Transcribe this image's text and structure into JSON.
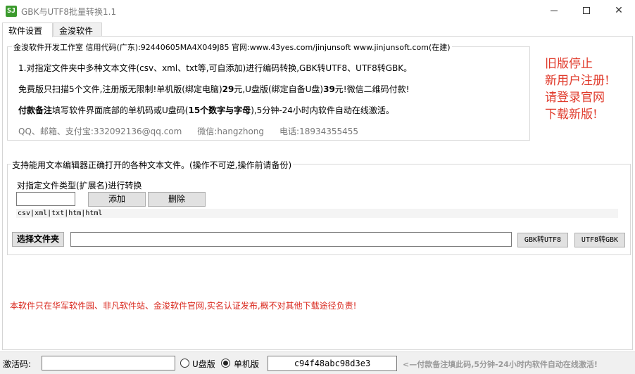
{
  "window": {
    "title": "GBK与UTF8批量转换1.1",
    "icon_text": "SJ"
  },
  "tabs": [
    {
      "label": "软件设置",
      "active": true
    },
    {
      "label": "金浚软件",
      "active": false
    }
  ],
  "info_group": {
    "legend": "金浚软件开发工作室 信用代码(广东):92440605MA4X049J85 官网:www.43yes.com/jinjunsoft  www.jinjunsoft.com(在建)",
    "line1": "1.对指定文件夹中多种文本文件(csv、xml、txt等,可自添加)进行编码转换,GBK转UTF8、UTF8转GBK。",
    "line2_a": "免费版只扫描5个文件,注册版无限制!单机版(绑定电脑)",
    "line2_price1": "29",
    "line2_b": "元,U盘版(绑定自备U盘)",
    "line2_price2": "39",
    "line2_c": "元!微信二维码付款!",
    "line3_bold": "付款备注",
    "line3_a": "填写软件界面底部的单机码或U盘码(",
    "line3_bold2": "15个数字与字母",
    "line3_b": "),5分钟-24小时内软件自动在线激活。",
    "contact_qq": "QQ、邮箱、支付宝:332092136@qq.com",
    "contact_wechat": "微信:hangzhong",
    "contact_phone": "电话:18934355455"
  },
  "red_notice": [
    "旧版停止",
    "新用户注册!",
    "请登录官网",
    "下载新版!"
  ],
  "convert_group": {
    "legend": "支持能用文本编辑器正确打开的各种文本文件。(操作不可逆,操作前请备份)",
    "ext_label": "对指定文件类型(扩展名)进行转换",
    "ext_input_value": "",
    "add_label": "添加",
    "delete_label": "删除",
    "ext_list": "csv|xml|txt|htm|html",
    "folder_label": "选择文件夹",
    "path_value": "",
    "gbk_to_utf8_label": "GBK转UTF8",
    "utf8_to_gbk_label": "UTF8转GBK"
  },
  "footer_notice": "本软件只在华军软件园、非凡软件站、金浚软件官网,实名认证发布,概不对其他下载途径负责!",
  "statusbar": {
    "activation_label": "激活码:",
    "activation_value": "",
    "radio_usb_label": "U盘版",
    "radio_standalone_label": "单机版",
    "selected": "单机版",
    "machine_code": "c94f48abc98d3e3",
    "hint": "<—付款备注填此码,5分钟-24小时内软件自动在线激活!"
  }
}
